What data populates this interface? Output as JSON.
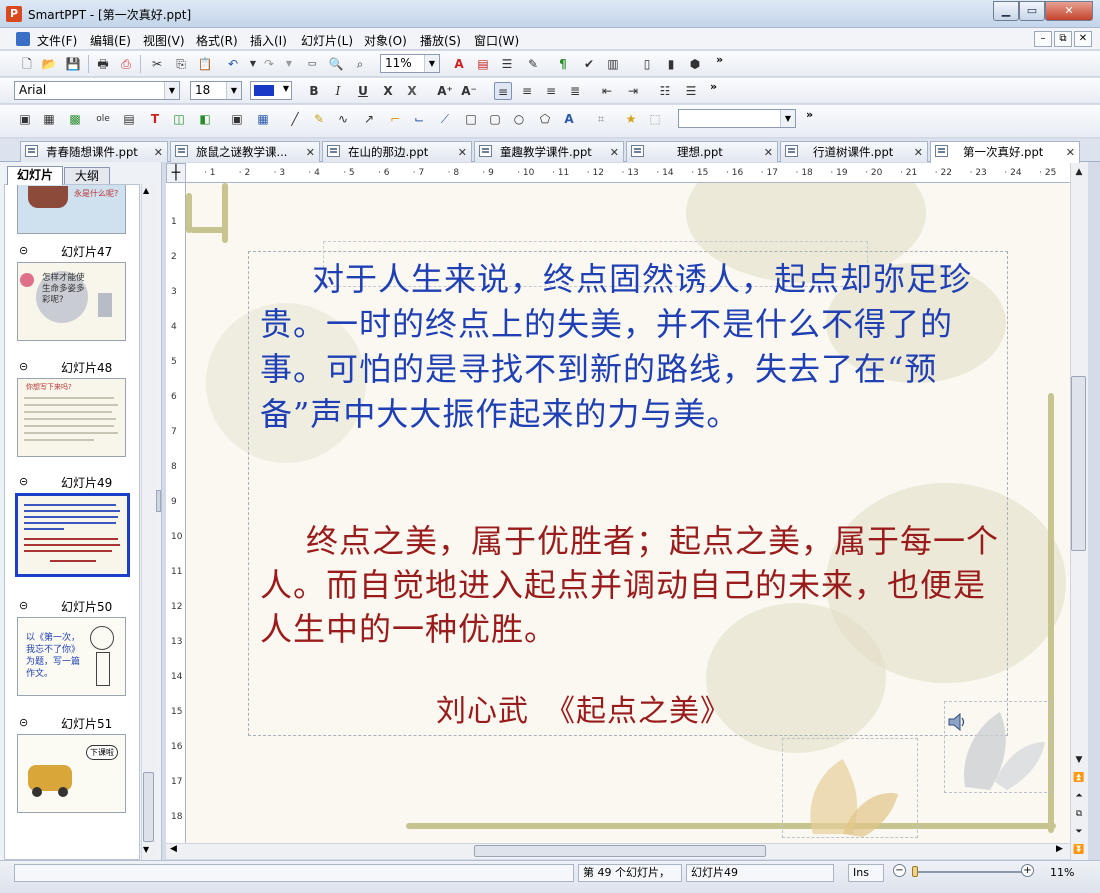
{
  "window": {
    "title": "SmartPPT - [第一次真好.ppt]",
    "app_icon": "P"
  },
  "menu": [
    "文件(F)",
    "编辑(E)",
    "视图(V)",
    "格式(R)",
    "插入(I)",
    "幻灯片(L)",
    "对象(O)",
    "播放(S)",
    "窗口(W)"
  ],
  "toolbar": {
    "zoom": "11%",
    "font_name": "Arial",
    "font_size": "18",
    "more": "»",
    "align_left_icon": "≡"
  },
  "tabs": [
    {
      "label": "青春随想课件.ppt",
      "close": "✕"
    },
    {
      "label": "旅鼠之谜教学课...",
      "close": "✕"
    },
    {
      "label": "在山的那边.ppt",
      "close": "✕"
    },
    {
      "label": "童趣教学课件.ppt",
      "close": "✕"
    },
    {
      "label": "理想.ppt",
      "close": "✕"
    },
    {
      "label": "行道树课件.ppt",
      "close": "✕"
    },
    {
      "label": "第一次真好.ppt",
      "close": "✕"
    }
  ],
  "panel": {
    "tab_slides": "幻灯片",
    "tab_outline": "大纲"
  },
  "thumbs": [
    {
      "label": "幻灯片47",
      "text": "怎样才能使生命多姿多彩呢?"
    },
    {
      "label": "幻灯片48",
      "text": "你想写下来吗?"
    },
    {
      "label": "幻灯片49",
      "text": ""
    },
    {
      "label": "幻灯片50",
      "text": "以《第一次，我忘不了你》为题，写一篇作文。"
    },
    {
      "label": "幻灯片51",
      "text": "下课啦"
    }
  ],
  "thumb_top_text": "永是什么呢?",
  "ruler": {
    "h": [
      "1",
      "2",
      "3",
      "4",
      "5",
      "6",
      "7",
      "8",
      "9",
      "10",
      "11",
      "12",
      "13",
      "14",
      "15",
      "16",
      "17",
      "18",
      "19",
      "20",
      "21",
      "22",
      "23",
      "24",
      "25"
    ],
    "v": [
      "1",
      "2",
      "3",
      "4",
      "5",
      "6",
      "7",
      "8",
      "9",
      "10",
      "11",
      "12",
      "13",
      "14",
      "15",
      "16",
      "17",
      "18"
    ]
  },
  "slide": {
    "para1": "对于人生来说，终点固然诱人，起点却弥足珍贵。一时的终点上的失美，并不是什么不得了的事。可怕的是寻找不到新的路线，失去了在“预备”声中大大振作起来的力与美。",
    "para2": "终点之美，属于优胜者；起点之美，属于每一个人。而自觉地进入起点并调动自己的未来，也便是人生中的一种优胜。",
    "author": "刘心武　《起点之美》"
  },
  "status": {
    "slide_count": "第 49 个幻灯片，",
    "slide_name": "幻灯片49",
    "mode": "Ins",
    "zoom": "11%"
  },
  "colors": {
    "accent_blue": "#1f3fb4",
    "accent_red": "#9a1b1b",
    "selected_thumb": "#1c3fc9"
  }
}
